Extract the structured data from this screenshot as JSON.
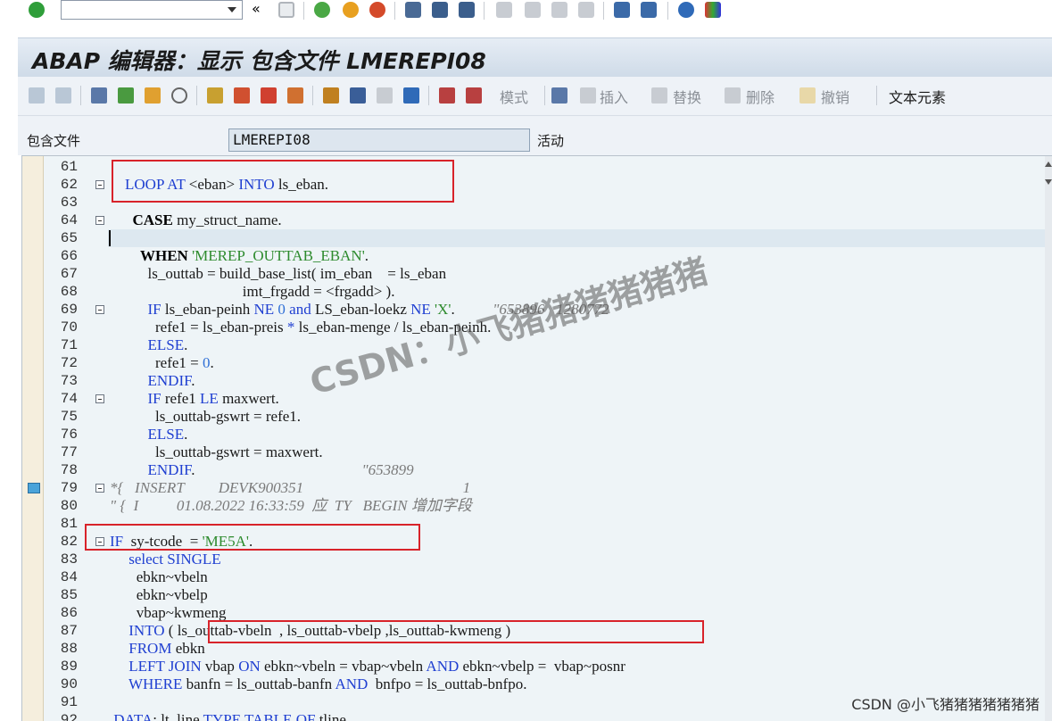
{
  "system_toolbar": {
    "command_field_value": "",
    "icons": [
      "check-icon",
      "collapse-icon",
      "save-icon",
      "back-icon",
      "exit-icon",
      "cancel-icon",
      "print-icon",
      "find-icon",
      "find-next-icon",
      "first-page-icon",
      "prev-page-icon",
      "next-page-icon",
      "last-page-icon",
      "new-session-icon",
      "shortcut-icon",
      "help-icon",
      "layout-icon"
    ]
  },
  "title": "ABAP 编辑器：显示 包含文件 LMEREPI08",
  "app_toolbar": {
    "mode_label": "模式",
    "insert_label": "插入",
    "replace_label": "替换",
    "delete_label": "删除",
    "undo_label": "撤销",
    "text_elements_label": "文本元素"
  },
  "header": {
    "include_label": "包含文件",
    "include_value": "LMEREPI08",
    "status": "活动"
  },
  "editor": {
    "lines": [
      {
        "no": "61",
        "html": ""
      },
      {
        "no": "62",
        "html": "    <span class='kw'>LOOP AT</span> &lt;eban&gt; <span class='kw'>INTO</span> ls_eban."
      },
      {
        "no": "63",
        "html": ""
      },
      {
        "no": "64",
        "html": "      <span class='kwb'>CASE</span> my_struct_name."
      },
      {
        "no": "65",
        "html": ""
      },
      {
        "no": "66",
        "html": "        <span class='kwb'>WHEN</span> <span class='str'>'MEREP_OUTTAB_EBAN'</span>."
      },
      {
        "no": "67",
        "html": "          ls_outtab = build_base_list( im_eban    = ls_eban"
      },
      {
        "no": "68",
        "html": "                                   imt_frgadd = &lt;frgadd&gt; )."
      },
      {
        "no": "69",
        "html": "          <span class='kw'>IF</span> ls_eban-peinh <span class='kw'>NE</span> <span class='num'>0</span> <span class='kw'>and</span> LS_eban-loekz <span class='kw'>NE</span> <span class='str'>'X'</span>.          <span class='cmt'>\"653896   1280772</span>"
      },
      {
        "no": "70",
        "html": "            refe1 = ls_eban-preis <span class='kw'>*</span> ls_eban-menge / ls_eban-peinh."
      },
      {
        "no": "71",
        "html": "          <span class='kw'>ELSE</span>."
      },
      {
        "no": "72",
        "html": "            refe1 = <span class='num'>0</span>."
      },
      {
        "no": "73",
        "html": "          <span class='kw'>ENDIF</span>."
      },
      {
        "no": "74",
        "html": "          <span class='kw'>IF</span> refe1 <span class='kw'>LE</span> maxwert."
      },
      {
        "no": "75",
        "html": "            ls_outtab-gswrt = refe1."
      },
      {
        "no": "76",
        "html": "          <span class='kw'>ELSE</span>."
      },
      {
        "no": "77",
        "html": "            ls_outtab-gswrt = maxwert."
      },
      {
        "no": "78",
        "html": "          <span class='kw'>ENDIF</span>.                                            <span class='cmt'>\"653899</span>"
      },
      {
        "no": "79",
        "html": "<span class='cmt'>*{   INSERT         DEVK900351                                          1</span>"
      },
      {
        "no": "80",
        "html": "<span class='cmt'>\" {  I          01.08.2022 16:33:59  应  TY   BEGIN 增加字段</span>"
      },
      {
        "no": "81",
        "html": ""
      },
      {
        "no": "82",
        "html": "<span class='kw'>IF</span>  sy-tcode  = <span class='str'>'ME5A'</span>."
      },
      {
        "no": "83",
        "html": "     <span class='kw'>select SINGLE</span>"
      },
      {
        "no": "84",
        "html": "       ebkn~vbeln"
      },
      {
        "no": "85",
        "html": "       ebkn~vbelp"
      },
      {
        "no": "86",
        "html": "       vbap~kwmeng"
      },
      {
        "no": "87",
        "html": "     <span class='kw'>INTO</span> ( ls_outtab-vbeln  , ls_outtab-vbelp ,ls_outtab-kwmeng )"
      },
      {
        "no": "88",
        "html": "     <span class='kw'>FROM</span> ebkn"
      },
      {
        "no": "89",
        "html": "     <span class='kw'>LEFT JOIN</span> vbap <span class='kw'>ON</span> ebkn~vbeln = vbap~vbeln <span class='kw'>AND</span> ebkn~vbelp =  vbap~posnr"
      },
      {
        "no": "90",
        "html": "     <span class='kw'>WHERE</span> banfn = ls_outtab-banfn <span class='kw'>AND</span>  bnfpo = ls_outtab-bnfpo."
      },
      {
        "no": "91",
        "html": ""
      },
      {
        "no": "92",
        "html": " <span class='kw'>DATA</span>: lt_line <span class='kw'>TYPE TABLE OF</span> tline."
      }
    ]
  },
  "watermark": "CSDN：小飞猪猪猪猪猪猪",
  "footer_watermark": "CSDN @小飞猪猪猪猪猪猪猪"
}
